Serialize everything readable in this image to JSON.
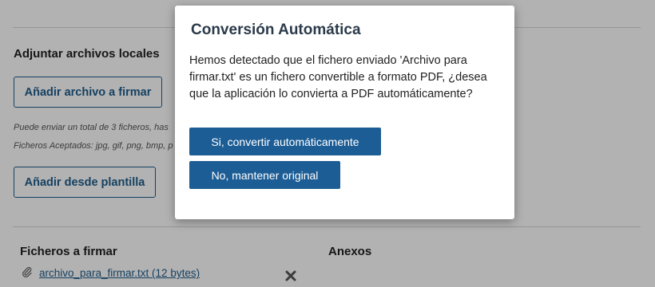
{
  "background": {
    "local_files_title": "Adjuntar archivos locales",
    "add_file_button": "Añadir archivo a firmar",
    "hint_line_1": "Puede enviar un total de 3 ficheros, has",
    "hint_line_2": "Ficheros Aceptados: jpg, gif, png, bmp, p",
    "add_template_button": "Añadir desde plantilla",
    "files_to_sign_title": "Ficheros a firmar",
    "attachments_title": "Anexos",
    "file_link": "archivo_para_firmar.txt (12 bytes)"
  },
  "modal": {
    "title": "Conversión Automática",
    "message": "Hemos detectado que el fichero enviado 'Archivo para firmar.txt' es un fichero convertible a formato PDF, ¿desea que la aplicación lo convierta a PDF automáticamente?",
    "convert_button": "Si, convertir automáticamente",
    "keep_button": "No, mantener original"
  },
  "colors": {
    "primary": "#1c5d95",
    "overlay": "rgba(0,0,0,0.30)"
  },
  "icons": {
    "attachment": "paperclip-icon",
    "remove": "close-icon"
  }
}
